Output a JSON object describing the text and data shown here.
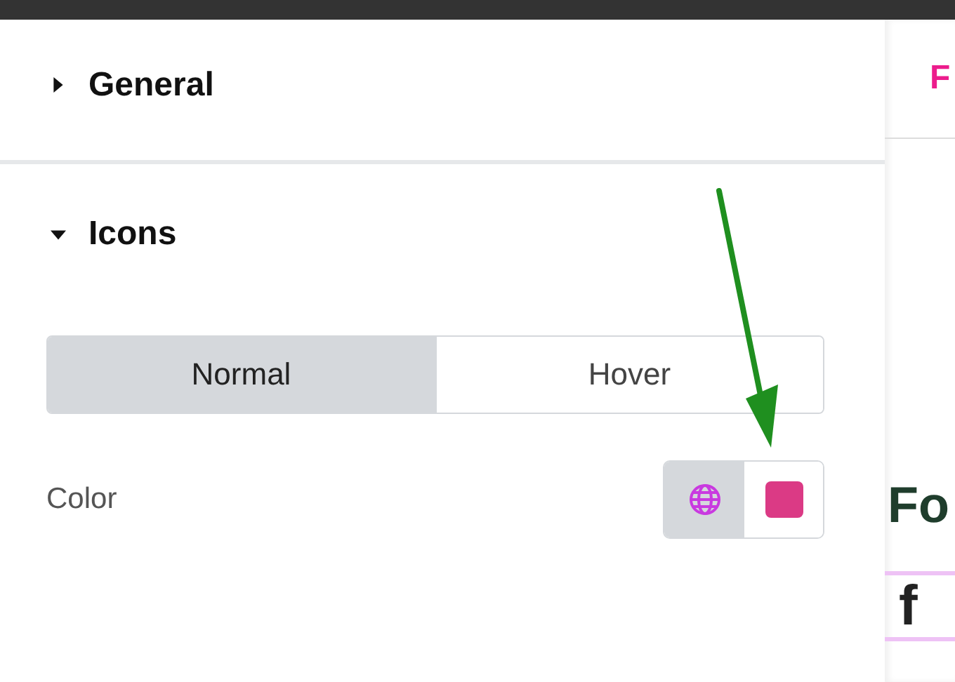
{
  "sections": [
    {
      "title": "General",
      "expanded": false
    },
    {
      "title": "Icons",
      "expanded": true
    }
  ],
  "tabs": [
    {
      "label": "Normal",
      "selected": true
    },
    {
      "label": "Hover",
      "selected": false
    }
  ],
  "color_control": {
    "label": "Color",
    "color": "#db3a85"
  },
  "preview": {
    "logo_letter": "F",
    "heading": "Fo",
    "social_icon": "f"
  }
}
